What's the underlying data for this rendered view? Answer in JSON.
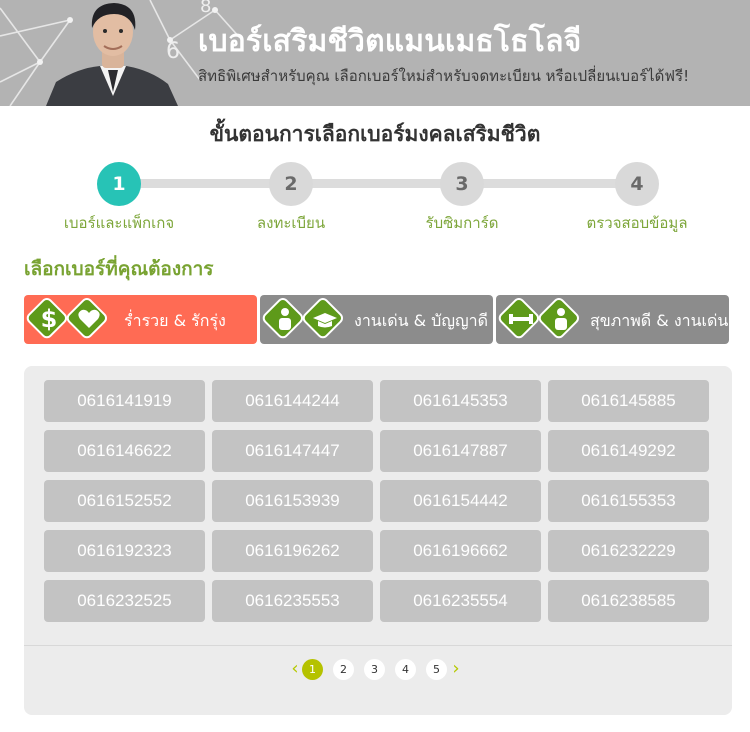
{
  "banner": {
    "title": "เบอร์เสริมชีวิตแมนเมธโธโลจี",
    "subtitle": "สิทธิพิเศษสำหรับคุณ เลือกเบอร์ใหม่สำหรับจดทะเบียน หรือเปลี่ยนเบอร์ได้ฟรี!"
  },
  "steps": {
    "title": "ขั้นตอนการเลือกเบอร์มงคลเสริมชีวิต",
    "items": [
      {
        "number": "1",
        "label": "เบอร์และแพ็กเกจ",
        "active": true
      },
      {
        "number": "2",
        "label": "ลงทะเบียน",
        "active": false
      },
      {
        "number": "3",
        "label": "รับซิมการ์ด",
        "active": false
      },
      {
        "number": "4",
        "label": "ตรวจสอบข้อมูล",
        "active": false
      }
    ]
  },
  "section_title": "เลือกเบอร์ที่คุณต้องการ",
  "categories": [
    {
      "label": "ร่ำรวย & รักรุ่ง",
      "icons": [
        "dollar-icon",
        "heart-hands-icon"
      ],
      "active": true
    },
    {
      "label": "งานเด่น & บัญญาดี",
      "icons": [
        "person-tie-icon",
        "graduation-cap-icon"
      ],
      "active": false
    },
    {
      "label": "สุขภาพดี & งานเด่น",
      "icons": [
        "dumbbell-icon",
        "person-tie-icon"
      ],
      "active": false
    }
  ],
  "numbers": [
    [
      "0616141919",
      "0616144244",
      "0616145353",
      "0616145885"
    ],
    [
      "0616146622",
      "0616147447",
      "0616147887",
      "0616149292"
    ],
    [
      "0616152552",
      "0616153939",
      "0616154442",
      "0616155353"
    ],
    [
      "0616192323",
      "0616196262",
      "0616196662",
      "0616232229"
    ],
    [
      "0616232525",
      "0616235553",
      "0616235554",
      "0616238585"
    ]
  ],
  "pagination": {
    "prev": "‹",
    "next": "›",
    "pages": [
      "1",
      "2",
      "3",
      "4",
      "5"
    ],
    "current": "1"
  },
  "colors": {
    "accent_teal": "#27c3b6",
    "accent_green": "#79a332",
    "active_tab": "#ff6b54",
    "inactive_tab": "#8c8c8c",
    "number_tile": "#c3c3c3",
    "pager_active": "#b5c200"
  }
}
